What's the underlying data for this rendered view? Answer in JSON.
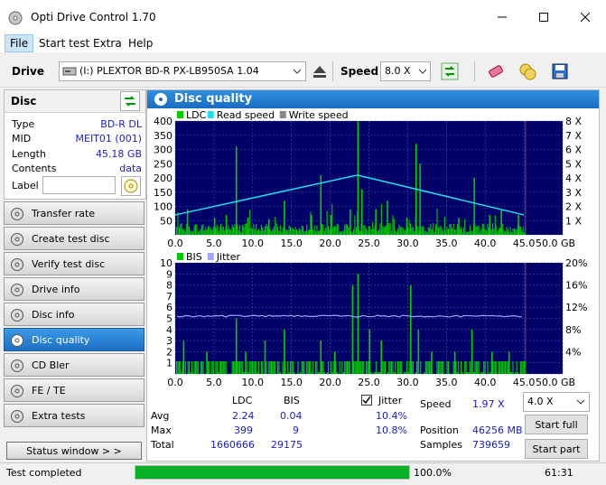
{
  "window": {
    "title": "Opti Drive Control 1.70"
  },
  "menu": [
    "File",
    "Start test",
    "Extra",
    "Help"
  ],
  "toolbar": {
    "drive_label": "Drive",
    "drive_value": "(I:)   PLEXTOR BD-R  PX-LB950SA 1.04",
    "speed_label": "Speed",
    "speed_value": "8.0 X"
  },
  "disc": {
    "header": "Disc",
    "rows": [
      {
        "label": "Type",
        "value": "BD-R DL"
      },
      {
        "label": "MID",
        "value": "MEIT01 (001)"
      },
      {
        "label": "Length",
        "value": "45.18 GB"
      },
      {
        "label": "Contents",
        "value": "data"
      }
    ],
    "label_label": "Label",
    "label_value": ""
  },
  "nav": [
    {
      "label": "Transfer rate",
      "icon": "disc-icon"
    },
    {
      "label": "Create test disc",
      "icon": "disc-icon"
    },
    {
      "label": "Verify test disc",
      "icon": "disc-icon"
    },
    {
      "label": "Drive info",
      "icon": "disc-icon"
    },
    {
      "label": "Disc info",
      "icon": "disc-icon"
    },
    {
      "label": "Disc quality",
      "icon": "disc-icon",
      "active": true
    },
    {
      "label": "CD Bler",
      "icon": "disc-icon"
    },
    {
      "label": "FE / TE",
      "icon": "disc-icon"
    },
    {
      "label": "Extra tests",
      "icon": "disc-icon"
    }
  ],
  "status_window_button": "Status window > >",
  "main": {
    "title": "Disc quality"
  },
  "chart_data": [
    {
      "type": "bar",
      "legend": [
        "LDC",
        "Read speed",
        "Write speed"
      ],
      "colors": {
        "ldc": "#00cc00",
        "read": "#22ddee",
        "write": "#888888",
        "bg": "#000068",
        "grid": "#3a5a9a"
      },
      "y_left_ticks": [
        "400",
        "350",
        "300",
        "250",
        "200",
        "150",
        "100",
        "50"
      ],
      "y_right_ticks": [
        "8 X",
        "7 X",
        "6 X",
        "5 X",
        "4 X",
        "3 X",
        "2 X",
        "1 X"
      ],
      "x_ticks": [
        "0.0",
        "5.0",
        "10.0",
        "15.0",
        "20.0",
        "25.0",
        "30.0",
        "35.0",
        "40.0",
        "45.0",
        "50.0 GB"
      ],
      "xlim": [
        0,
        50
      ],
      "ylim": [
        0,
        400
      ],
      "y2lim": [
        0,
        8
      ],
      "read_speed": [
        {
          "x": 0,
          "y": 1.4
        },
        {
          "x": 23.5,
          "y": 4.2
        },
        {
          "x": 45,
          "y": 1.4
        }
      ],
      "ldc_spikes": [
        {
          "x": 1.5,
          "y": 90
        },
        {
          "x": 5,
          "y": 60
        },
        {
          "x": 6.5,
          "y": 70
        },
        {
          "x": 7.8,
          "y": 310
        },
        {
          "x": 9.3,
          "y": 60
        },
        {
          "x": 12,
          "y": 55
        },
        {
          "x": 14,
          "y": 120
        },
        {
          "x": 17.5,
          "y": 70
        },
        {
          "x": 18.7,
          "y": 210
        },
        {
          "x": 20,
          "y": 70
        },
        {
          "x": 22.5,
          "y": 90
        },
        {
          "x": 23.5,
          "y": 399
        },
        {
          "x": 24,
          "y": 160
        },
        {
          "x": 25.8,
          "y": 90
        },
        {
          "x": 27.3,
          "y": 120
        },
        {
          "x": 29.8,
          "y": 60
        },
        {
          "x": 31,
          "y": 320
        },
        {
          "x": 31.5,
          "y": 250
        },
        {
          "x": 36.5,
          "y": 60
        },
        {
          "x": 38.5,
          "y": 200
        },
        {
          "x": 40.5,
          "y": 70
        },
        {
          "x": 42,
          "y": 90
        },
        {
          "x": 44.2,
          "y": 70
        }
      ],
      "end_marker_x": 45.2
    },
    {
      "type": "bar",
      "legend": [
        "BIS",
        "Jitter"
      ],
      "colors": {
        "bis": "#00cc00",
        "jitter": "#9fa8ff",
        "bg": "#000068",
        "grid": "#3a5a9a"
      },
      "y_left_ticks": [
        "10",
        "9",
        "8",
        "7",
        "6",
        "5",
        "4",
        "3",
        "2",
        "1"
      ],
      "y_right_ticks": [
        "20%",
        "16%",
        "12%",
        "8%",
        "4%"
      ],
      "x_ticks": [
        "0.0",
        "5.0",
        "10.0",
        "15.0",
        "20.0",
        "25.0",
        "30.0",
        "35.0",
        "40.0",
        "45.0",
        "50.0 GB"
      ],
      "xlim": [
        0,
        50
      ],
      "ylim": [
        0,
        10
      ],
      "y2lim": [
        0,
        20
      ],
      "jitter_percent": 10.4,
      "bis_spikes": [
        {
          "x": 1,
          "y": 3
        },
        {
          "x": 4,
          "y": 2
        },
        {
          "x": 7.8,
          "y": 5
        },
        {
          "x": 9,
          "y": 2
        },
        {
          "x": 11.5,
          "y": 3
        },
        {
          "x": 14,
          "y": 4
        },
        {
          "x": 18.7,
          "y": 3
        },
        {
          "x": 20.5,
          "y": 2
        },
        {
          "x": 22.8,
          "y": 8
        },
        {
          "x": 23.5,
          "y": 9
        },
        {
          "x": 25,
          "y": 4
        },
        {
          "x": 26.5,
          "y": 3
        },
        {
          "x": 30.3,
          "y": 8
        },
        {
          "x": 31.3,
          "y": 4
        },
        {
          "x": 33,
          "y": 2
        },
        {
          "x": 36,
          "y": 2
        },
        {
          "x": 38.2,
          "y": 4
        },
        {
          "x": 40.8,
          "y": 2
        },
        {
          "x": 43,
          "y": 2
        }
      ],
      "end_marker_x": 45.2
    }
  ],
  "stats": {
    "col_ldc": "LDC",
    "col_bis": "BIS",
    "jitter_label": "Jitter",
    "rows": [
      {
        "label": "Avg",
        "ldc": "2.24",
        "bis": "0.04",
        "jitter": "10.4%"
      },
      {
        "label": "Max",
        "ldc": "399",
        "bis": "9",
        "jitter": "10.8%"
      },
      {
        "label": "Total",
        "ldc": "1660666",
        "bis": "29175",
        "jitter": ""
      }
    ],
    "speed_label": "Speed",
    "speed_value": "1.97 X",
    "position_label": "Position",
    "position_value": "46256 MB",
    "samples_label": "Samples",
    "samples_value": "739659",
    "speed_select": "4.0 X",
    "start_full": "Start full",
    "start_part": "Start part"
  },
  "statusbar": {
    "text": "Test completed",
    "progress": 100.0,
    "progress_text": "100.0%",
    "time": "61:31"
  }
}
